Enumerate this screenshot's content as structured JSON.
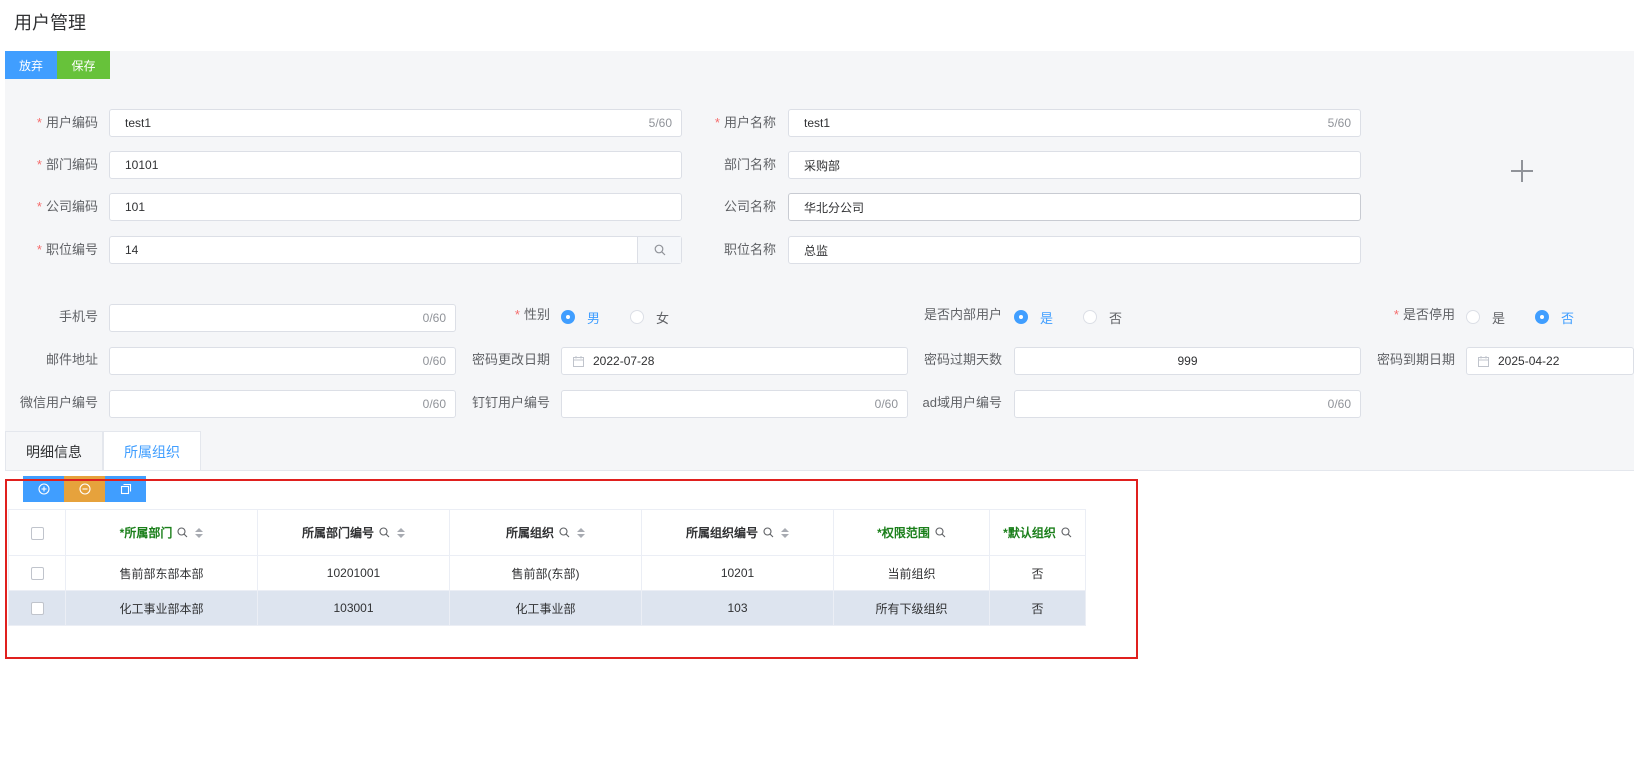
{
  "page_title": "用户管理",
  "toolbar": {
    "discard_label": "放弃",
    "save_label": "保存"
  },
  "form": {
    "user_code": {
      "label": "用户编码",
      "value": "test1",
      "count": "5/60"
    },
    "user_name": {
      "label": "用户名称",
      "value": "test1",
      "count": "5/60"
    },
    "dept_code": {
      "label": "部门编码",
      "value": "10101"
    },
    "dept_name": {
      "label": "部门名称",
      "value": "采购部"
    },
    "company_code": {
      "label": "公司编码",
      "value": "101"
    },
    "company_name": {
      "label": "公司名称",
      "value": "华北分公司"
    },
    "position_code": {
      "label": "职位编号",
      "value": "14"
    },
    "position_name": {
      "label": "职位名称",
      "value": "总监"
    },
    "mobile": {
      "label": "手机号",
      "value": "",
      "count": "0/60"
    },
    "gender": {
      "label": "性别",
      "options": [
        "男",
        "女"
      ],
      "selected": "男"
    },
    "internal_user": {
      "label": "是否内部用户",
      "options": [
        "是",
        "否"
      ],
      "selected": "是"
    },
    "disabled": {
      "label": "是否停用",
      "options": [
        "是",
        "否"
      ],
      "selected": "否"
    },
    "email": {
      "label": "邮件地址",
      "value": "",
      "count": "0/60"
    },
    "pwd_change_date": {
      "label": "密码更改日期",
      "value": "2022-07-28"
    },
    "pwd_expire_days": {
      "label": "密码过期天数",
      "value": "999"
    },
    "pwd_expire_date": {
      "label": "密码到期日期",
      "value": "2025-04-22"
    },
    "wechat_id": {
      "label": "微信用户编号",
      "value": "",
      "count": "0/60"
    },
    "dingtalk_id": {
      "label": "钉钉用户编号",
      "value": "",
      "count": "0/60"
    },
    "ad_id": {
      "label": "ad域用户编号",
      "value": "",
      "count": "0/60"
    }
  },
  "tabs": [
    "明细信息",
    "所属组织"
  ],
  "active_tab": "所属组织",
  "grid": {
    "columns": [
      "所属部门",
      "所属部门编号",
      "所属组织",
      "所属组织编号",
      "权限范围",
      "默认组织"
    ],
    "rows": [
      [
        "售前部东部本部",
        "10201001",
        "售前部(东部)",
        "10201",
        "当前组织",
        "否"
      ],
      [
        "化工事业部本部",
        "103001",
        "化工事业部",
        "103",
        "所有下级组织",
        "否"
      ]
    ]
  },
  "colors": {
    "primary": "#409eff",
    "success": "#67c23a",
    "warning": "#e6a23c",
    "required": "#f56c6c",
    "highlight": "#e0201e",
    "green_header": "#1a7f1a"
  }
}
